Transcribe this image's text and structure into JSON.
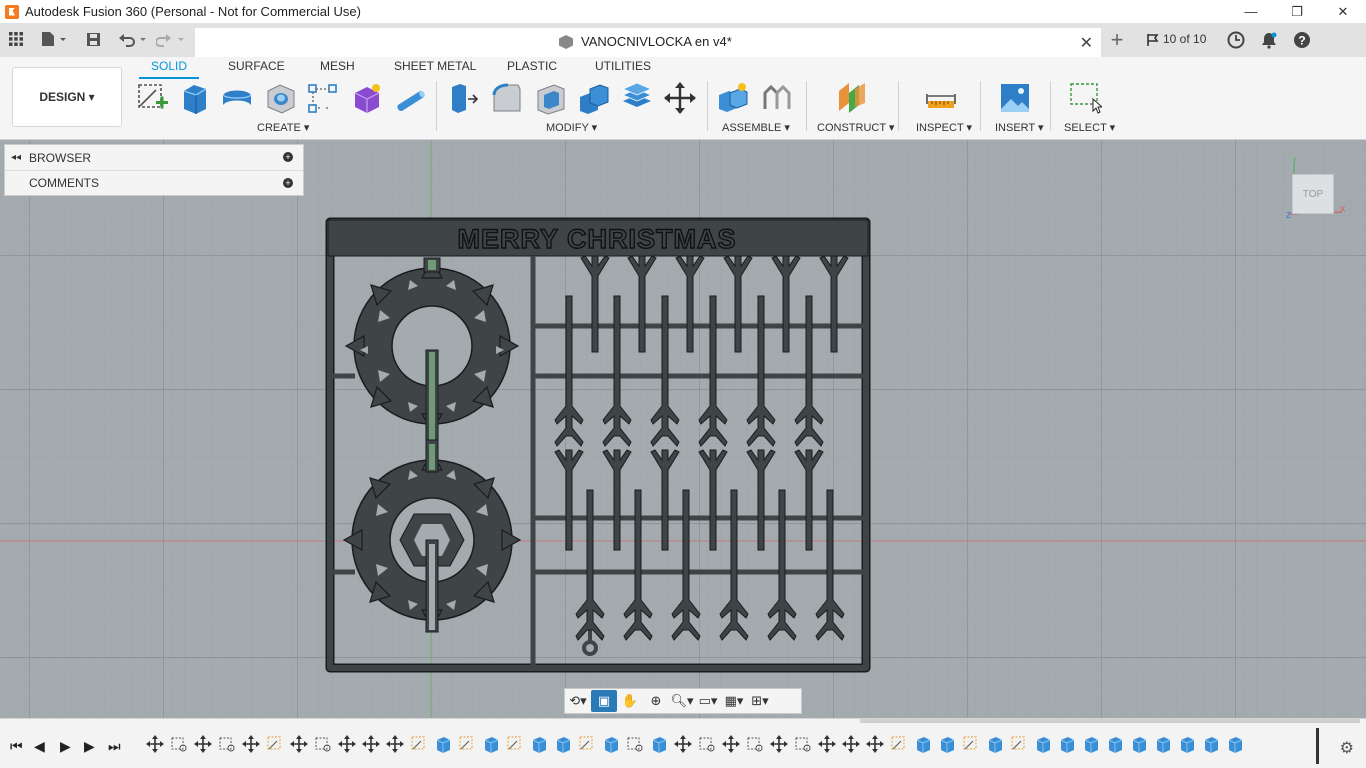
{
  "window": {
    "title": "Autodesk Fusion 360 (Personal - Not for Commercial Use)",
    "controls": [
      "—",
      "❐",
      "✕"
    ]
  },
  "tabbar": {
    "document_name": "VANOCNIVLOCKA en v4*",
    "close_glyph": "✕",
    "new_tab_glyph": "+",
    "page_count": "10 of 10"
  },
  "toolbar": {
    "workspace": "DESIGN ▾",
    "tabs": [
      "SOLID",
      "SURFACE",
      "MESH",
      "SHEET METAL",
      "PLASTIC",
      "UTILITIES"
    ],
    "active_tab": "SOLID",
    "groups": {
      "create": "CREATE ▾",
      "modify": "MODIFY ▾",
      "assemble": "ASSEMBLE ▾",
      "construct": "CONSTRUCT ▾",
      "inspect": "INSPECT ▾",
      "insert": "INSERT ▾",
      "select": "SELECT ▾"
    }
  },
  "panels": {
    "browser": "BROWSER",
    "comments": "COMMENTS"
  },
  "design": {
    "headline": "MERRY CHRISTMAS"
  },
  "viewcube": {
    "face": "TOP"
  },
  "colors": {
    "accent": "#0696d7",
    "viewport": "#8f989c",
    "grid": "#7f878b",
    "model": "#3f4447",
    "model_edge": "#1a1c1d"
  },
  "icons": {
    "apps": "grid-icon",
    "file": "file-icon",
    "save": "save-icon",
    "undo": "undo-icon",
    "redo": "redo-icon",
    "clock": "clock-icon",
    "bell": "bell-icon",
    "help": "help-icon"
  }
}
